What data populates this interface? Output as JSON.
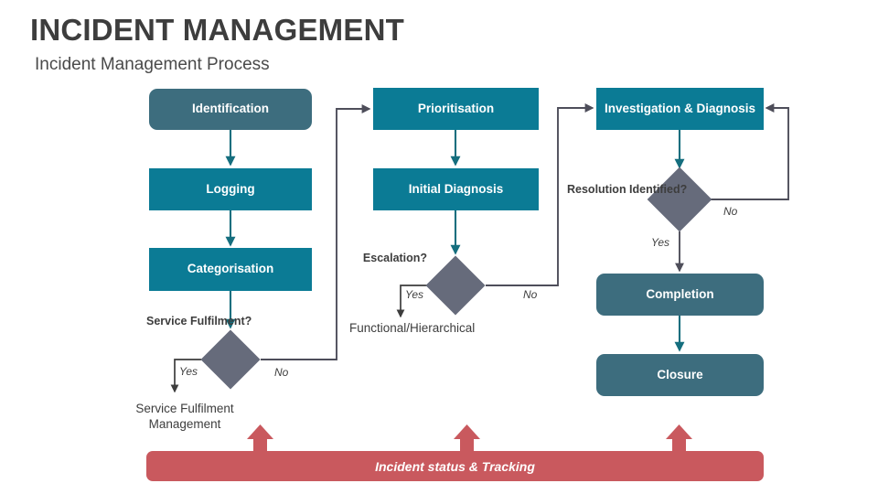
{
  "header": {
    "title": "INCIDENT MANAGEMENT",
    "subtitle": "Incident Management Process"
  },
  "nodes": {
    "identification": "Identification",
    "logging": "Logging",
    "categorisation": "Categorisation",
    "prioritisation": "Prioritisation",
    "initial_diagnosis": "Initial Diagnosis",
    "investigation_diagnosis": "Investigation & Diagnosis",
    "completion": "Completion",
    "closure": "Closure"
  },
  "decisions": {
    "service_fulfilment": {
      "label": "Service Fulfilment?",
      "yes": "Yes",
      "no": "No"
    },
    "escalation": {
      "label": "Escalation?",
      "yes": "Yes",
      "no": "No"
    },
    "resolution_identified": {
      "label": "Resolution Identified?",
      "yes": "Yes",
      "no": "No"
    }
  },
  "terminals": {
    "service_fulfilment_management": "Service Fulfilment Management",
    "functional_hierarchical": "Functional/Hierarchical"
  },
  "tracking_bar": {
    "label": "Incident status & Tracking"
  },
  "colors": {
    "teal_sharp": "#0b7b95",
    "teal_round": "#3d6d7e",
    "diamond_gray": "#666b7b",
    "connector_gray": "#4e4e5a",
    "connector_teal": "#156e7e",
    "tracking_red": "#c9595e",
    "title_gray": "#3d3d3d"
  }
}
